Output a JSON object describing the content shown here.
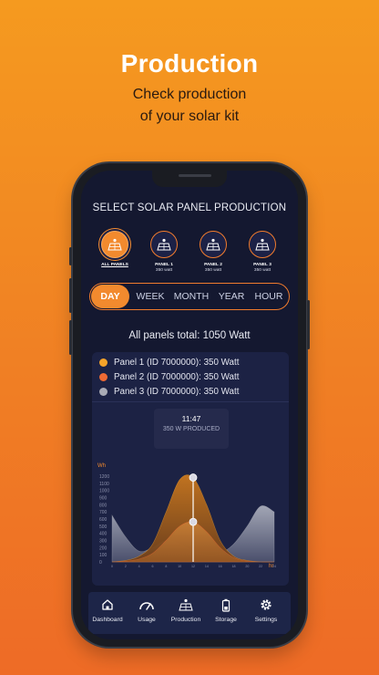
{
  "hero": {
    "title": "Production",
    "subtitle_line1": "Check production",
    "subtitle_line2": "of your solar kit"
  },
  "screen": {
    "title": "SELECT SOLAR PANEL PRODUCTION",
    "panels": [
      {
        "name": "ALL PANELS",
        "watt": "",
        "active": true
      },
      {
        "name": "PANEL 1",
        "watt": "350 watt",
        "active": false
      },
      {
        "name": "PANEL 2",
        "watt": "350 watt",
        "active": false
      },
      {
        "name": "PANEL 3",
        "watt": "350 watt",
        "active": false
      }
    ],
    "periods": [
      "DAY",
      "WEEK",
      "MONTH",
      "YEAR",
      "HOUR"
    ],
    "active_period": "DAY",
    "total": "All panels total: 1050 Watt",
    "legend": [
      {
        "label": "Panel 1 (ID 7000000): 350 Watt",
        "color": "#f5a32a"
      },
      {
        "label": "Panel 2 (ID 7000000): 350 Watt",
        "color": "#ef6a34"
      },
      {
        "label": "Panel 3 (ID 7000000): 350 Watt",
        "color": "#a9abb5"
      }
    ],
    "tooltip": {
      "time": "11:47",
      "value": "350 W PRODUCED"
    }
  },
  "chart_data": {
    "type": "area",
    "ylabel": "Wh",
    "xlabel": "hr",
    "ylim": [
      0,
      1200
    ],
    "y_ticks": [
      "1200",
      "1100",
      "1000",
      "900",
      "800",
      "700",
      "600",
      "500",
      "400",
      "300",
      "200",
      "100",
      "0"
    ],
    "x": [
      0,
      2,
      4,
      6,
      8,
      10,
      12,
      14,
      16,
      18,
      20,
      22,
      24
    ],
    "series": [
      {
        "name": "Panel 1",
        "color": "#f5a32a",
        "values": [
          0,
          20,
          80,
          250,
          700,
          1150,
          1180,
          800,
          300,
          80,
          20,
          0,
          0
        ]
      },
      {
        "name": "Panel 2",
        "color": "#ef6a34",
        "values": [
          0,
          10,
          40,
          120,
          300,
          500,
          560,
          420,
          200,
          60,
          10,
          0,
          0
        ]
      },
      {
        "name": "Panel 3",
        "color": "#a9abb5",
        "values": [
          650,
          350,
          150,
          200,
          300,
          250,
          150,
          100,
          120,
          250,
          500,
          780,
          700
        ]
      }
    ],
    "highlight_x": 12
  },
  "nav": [
    {
      "label": "Dashboard",
      "icon": "home-icon"
    },
    {
      "label": "Usage",
      "icon": "gauge-icon"
    },
    {
      "label": "Production",
      "icon": "solar-panel-icon"
    },
    {
      "label": "Storage",
      "icon": "battery-icon"
    },
    {
      "label": "Settings",
      "icon": "gear-icon"
    }
  ]
}
